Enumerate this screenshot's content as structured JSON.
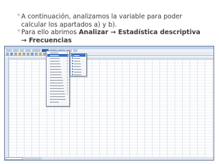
{
  "slide": {
    "bullet1": "A continuación, analizamos la variable para poder calcular los apartados a) y b).",
    "bullet2_prefix": "Para ello abrimos ",
    "bullet2_menu": "Analizar",
    "bullet2_arrow1": " → ",
    "bullet2_sub": "Estadística descriptiva",
    "bullet2_arrow2": " → ",
    "bullet2_target": "Frecuencias",
    "bullet_marker": "*"
  },
  "app": {
    "accent": "#2f66b5",
    "menu_highlight": "#3b6fbf",
    "analizar_items": 19,
    "descriptiva_items": 8,
    "highlighted_analizar_index": 1,
    "highlighted_descriptiva_index": 0
  }
}
